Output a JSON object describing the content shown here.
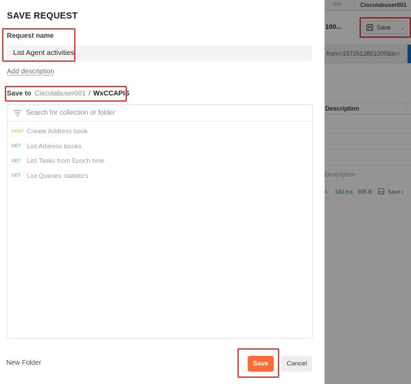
{
  "modal": {
    "title": "SAVE REQUEST",
    "request_name_label": "Request name",
    "request_name_value": "List Agent activities",
    "add_description": "Add description",
    "save_to_label": "Save to",
    "workspace": "Ciscolabuser001",
    "separator": "/",
    "collection": "WxCCAPIS",
    "search_placeholder": "Search for collection or folder",
    "requests": [
      {
        "method": "POST",
        "name": "Create Address book",
        "method_color": "#e8b44a"
      },
      {
        "method": "GET",
        "name": "List Address books",
        "method_color": "#6cc08a"
      },
      {
        "method": "GET",
        "name": "List Tasks from Epoch time",
        "method_color": "#6cc08a"
      },
      {
        "method": "GET",
        "name": "List Queues statistics",
        "method_color": "#6cc08a"
      }
    ],
    "new_folder": "New Folder",
    "save_button": "Save",
    "cancel_button": "Cancel",
    "accent_color": "#ff6c37",
    "highlight_color": "#e0403d"
  },
  "background": {
    "tab_dots": "ooo",
    "workspace_tab": "Ciscolabuser001",
    "request_title": "100...",
    "save_button": "Save",
    "url_text": "from=1672613851000&to=",
    "table_header": "Description",
    "description_placeholder": "Description",
    "response_chevron": "<",
    "response_time": "160 ms",
    "response_size": "905 B",
    "save_response": "Save r"
  }
}
